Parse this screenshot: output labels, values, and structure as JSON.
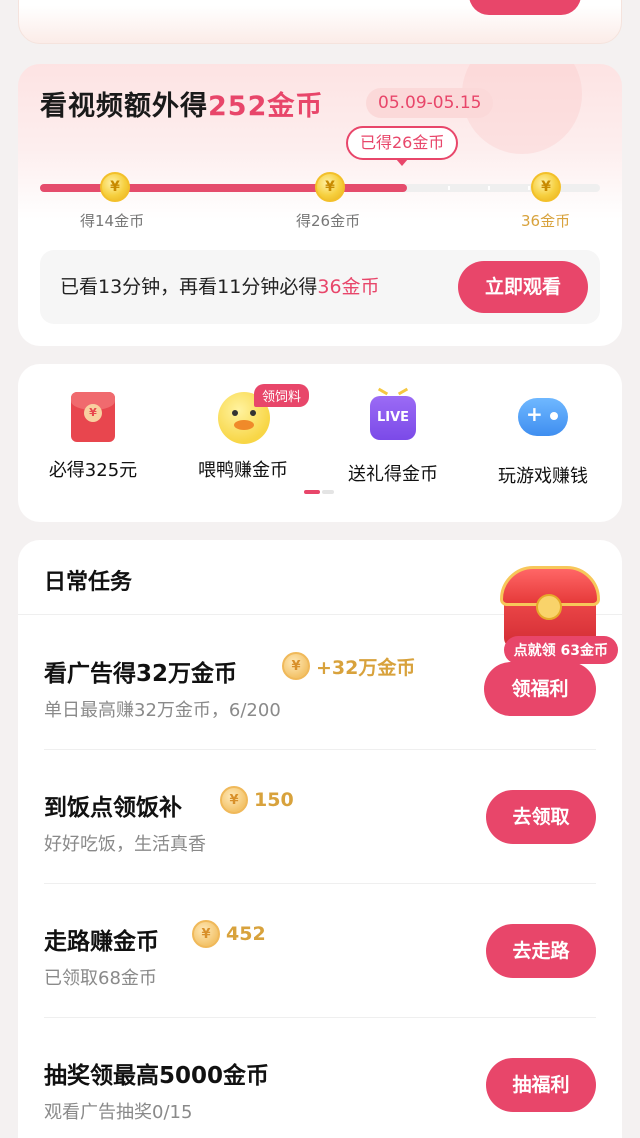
{
  "video_bonus": {
    "title_prefix": "看视频额外得",
    "title_amount": "252金币",
    "date_range": "05.09-05.15",
    "earned_tooltip": "已得26金币",
    "progress": 0.655,
    "milestones": [
      {
        "label": "得14金币",
        "coin": "¥"
      },
      {
        "label": "得26金币",
        "coin": "¥"
      },
      {
        "label": "36金币",
        "coin": "¥"
      }
    ],
    "status_prefix": "已看13分钟，再看11分钟必得",
    "status_amount": "36金币",
    "watch_button": "立即观看"
  },
  "shortcuts": {
    "items": [
      {
        "label": "必得325元",
        "icon": "red-packet-icon",
        "badge": "¥"
      },
      {
        "label": "喂鸭赚金币",
        "icon": "duck-icon",
        "tag": "领饲料"
      },
      {
        "label": "送礼得金币",
        "icon": "live-icon",
        "badge": "LIVE"
      },
      {
        "label": "玩游戏赚钱",
        "icon": "gamepad-icon"
      }
    ]
  },
  "daily_tasks": {
    "title": "日常任务",
    "chest_badge": "点就领 63金币",
    "tasks": [
      {
        "name": "看广告得32万金币",
        "reward": "+32万金币",
        "sub": "单日最高赚32万金币，6/200",
        "button": "领福利"
      },
      {
        "name": "到饭点领饭补",
        "reward": "150",
        "sub": "好好吃饭，生活真香",
        "button": "去领取"
      },
      {
        "name": "走路赚金币",
        "reward": "452",
        "sub": "已领取68金币",
        "button": "去走路"
      },
      {
        "name": "抽奖领最高5000金币",
        "reward": "",
        "sub": "观看广告抽奖0/15",
        "button": "抽福利"
      }
    ]
  },
  "colors": {
    "accent": "#e8466a",
    "gold": "#d8a23c"
  }
}
